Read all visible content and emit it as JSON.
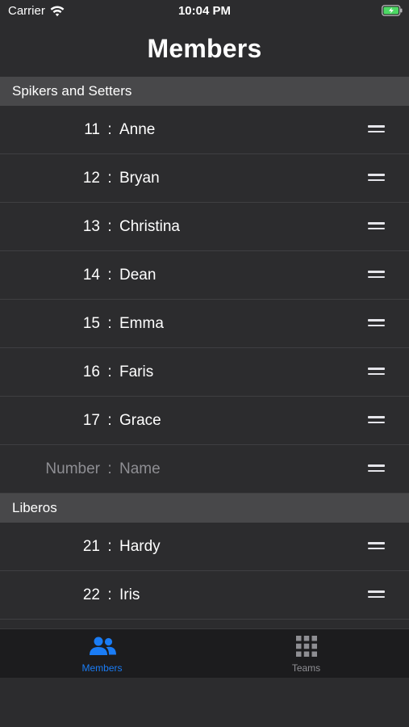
{
  "status_bar": {
    "carrier": "Carrier",
    "time": "10:04 PM"
  },
  "header": {
    "title": "Members"
  },
  "sections": [
    {
      "title": "Spikers and Setters",
      "rows": [
        {
          "number": "11",
          "name": "Anne"
        },
        {
          "number": "12",
          "name": "Bryan"
        },
        {
          "number": "13",
          "name": "Christina"
        },
        {
          "number": "14",
          "name": "Dean"
        },
        {
          "number": "15",
          "name": "Emma"
        },
        {
          "number": "16",
          "name": "Faris"
        },
        {
          "number": "17",
          "name": "Grace"
        }
      ],
      "new_row": {
        "number_placeholder": "Number",
        "name_placeholder": "Name"
      }
    },
    {
      "title": "Liberos",
      "rows": [
        {
          "number": "21",
          "name": "Hardy"
        },
        {
          "number": "22",
          "name": "Iris"
        }
      ]
    }
  ],
  "separator": ":",
  "tab_bar": {
    "tabs": [
      {
        "label": "Members",
        "icon": "people-icon",
        "active": true
      },
      {
        "label": "Teams",
        "icon": "grid-icon",
        "active": false
      }
    ]
  },
  "colors": {
    "accent": "#1a7cf5",
    "background": "#2c2c2e",
    "section_header": "#48484a",
    "placeholder": "#8e8e93",
    "battery_charging": "#4cd964"
  }
}
